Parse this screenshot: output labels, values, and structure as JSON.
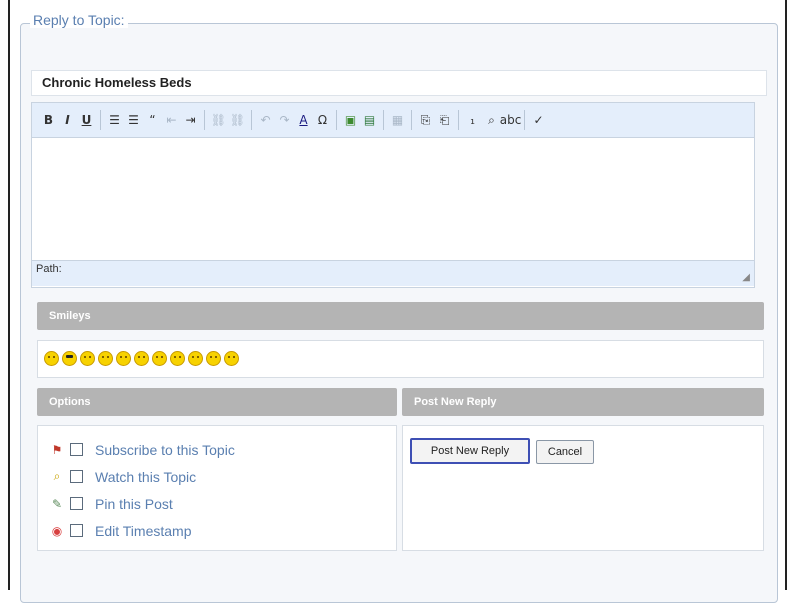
{
  "legend": "Reply to Topic:",
  "subject": {
    "value": "Chronic Homeless Beds"
  },
  "toolbar": {
    "buttons": [
      {
        "name": "bold-button",
        "glyph": "B",
        "cls": "b"
      },
      {
        "name": "italic-button",
        "glyph": "I",
        "cls": "i"
      },
      {
        "name": "underline-button",
        "glyph": "U",
        "cls": "u"
      },
      {
        "sep": true
      },
      {
        "name": "bullet-list-button",
        "glyph": "☰"
      },
      {
        "name": "numbered-list-button",
        "glyph": "☰"
      },
      {
        "name": "blockquote-button",
        "glyph": "“"
      },
      {
        "name": "outdent-button",
        "glyph": "⇤",
        "cls": "dim"
      },
      {
        "name": "indent-button",
        "glyph": "⇥"
      },
      {
        "sep": true
      },
      {
        "name": "link-button",
        "glyph": "⛓",
        "cls": "dim"
      },
      {
        "name": "unlink-button",
        "glyph": "⛓",
        "cls": "dim"
      },
      {
        "sep": true
      },
      {
        "name": "undo-button",
        "glyph": "↶",
        "cls": "dim"
      },
      {
        "name": "redo-button",
        "glyph": "↷",
        "cls": "dim"
      },
      {
        "name": "font-color-button",
        "glyph": "A"
      },
      {
        "name": "special-char-button",
        "glyph": "Ω"
      },
      {
        "sep": true
      },
      {
        "name": "image-button",
        "glyph": "▣"
      },
      {
        "name": "media-button",
        "glyph": "▤"
      },
      {
        "sep": true
      },
      {
        "name": "table-button",
        "glyph": "▦",
        "cls": "dim"
      },
      {
        "sep": true
      },
      {
        "name": "paste-button",
        "glyph": "⎘"
      },
      {
        "name": "paste-word-button",
        "glyph": "⎗"
      },
      {
        "sep": true
      },
      {
        "name": "subscript-button",
        "glyph": "₁"
      },
      {
        "name": "find-button",
        "glyph": "⌕"
      },
      {
        "name": "abbr-button",
        "glyph": "abc"
      },
      {
        "sep": true
      },
      {
        "name": "spellcheck-button",
        "glyph": "✓"
      }
    ],
    "path_label": "Path:"
  },
  "smileys": {
    "header": "Smileys",
    "items": [
      "smile",
      "cool",
      "neutral",
      "grin",
      "blush",
      "angry",
      "laugh",
      "wink",
      "shock",
      "sad",
      "tongue"
    ]
  },
  "options": {
    "header": "Options",
    "items": [
      {
        "label": "Subscribe to this Topic",
        "icon": "subscribe-icon",
        "glyph": "⚑",
        "color": "#c0392b"
      },
      {
        "label": "Watch this Topic",
        "icon": "magnifier-icon",
        "glyph": "⌕",
        "color": "#c8a200"
      },
      {
        "label": "Pin this Post",
        "icon": "pin-icon",
        "glyph": "✎",
        "color": "#5a8a5a"
      },
      {
        "label": "Edit Timestamp",
        "icon": "clock-icon",
        "glyph": "◉",
        "color": "#d84040"
      }
    ]
  },
  "post": {
    "header": "Post New Reply",
    "submit_label": "Post New Reply",
    "cancel_label": "Cancel"
  }
}
